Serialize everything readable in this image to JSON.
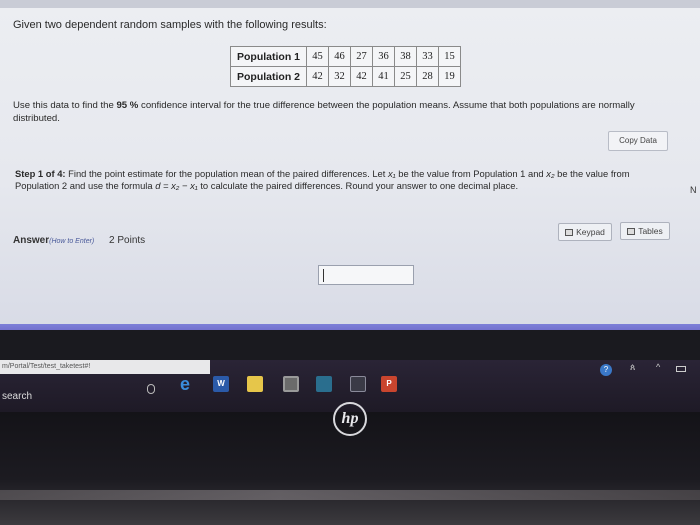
{
  "problem": {
    "intro": "Given two dependent random samples with the following results:",
    "table": {
      "rows": [
        {
          "label": "Population 1",
          "values": [
            "45",
            "46",
            "27",
            "36",
            "38",
            "33",
            "15"
          ]
        },
        {
          "label": "Population 2",
          "values": [
            "42",
            "32",
            "42",
            "41",
            "25",
            "28",
            "19"
          ]
        }
      ]
    },
    "question_pre": "Use this data to find the",
    "question_level": "95 %",
    "question_post": "confidence interval for the true difference between the population means. Assume that both populations are normally distributed.",
    "copy_data_label": "Copy Data"
  },
  "step": {
    "label": "Step 1 of 4:",
    "text_1": "Find the point estimate for the population mean of the paired differences. Let",
    "x1": "x₁",
    "text_2": "be the value from Population 1 and",
    "x2": "x₂",
    "text_3": "be the value from Population 2 and use the formula",
    "formula": "d = x₂ − x₁",
    "text_4": "to calculate the paired differences. Round your answer to one decimal place.",
    "edge_letter": "N"
  },
  "answer": {
    "label": "Answer",
    "how_to": "(How to Enter)",
    "points": "2 Points",
    "keypad_label": "Keypad",
    "tables_label": "Tables",
    "input_value": ""
  },
  "taskbar": {
    "url_tooltip": "m/Portal/Test/test_taketest#!",
    "search_label": "search",
    "word_glyph": "W",
    "ppt_glyph": "P",
    "edge_glyph": "e",
    "help_glyph": "?",
    "people_glyph": "ጰ",
    "chevron_glyph": "^"
  },
  "bezel": {
    "logo_text": "hp"
  }
}
